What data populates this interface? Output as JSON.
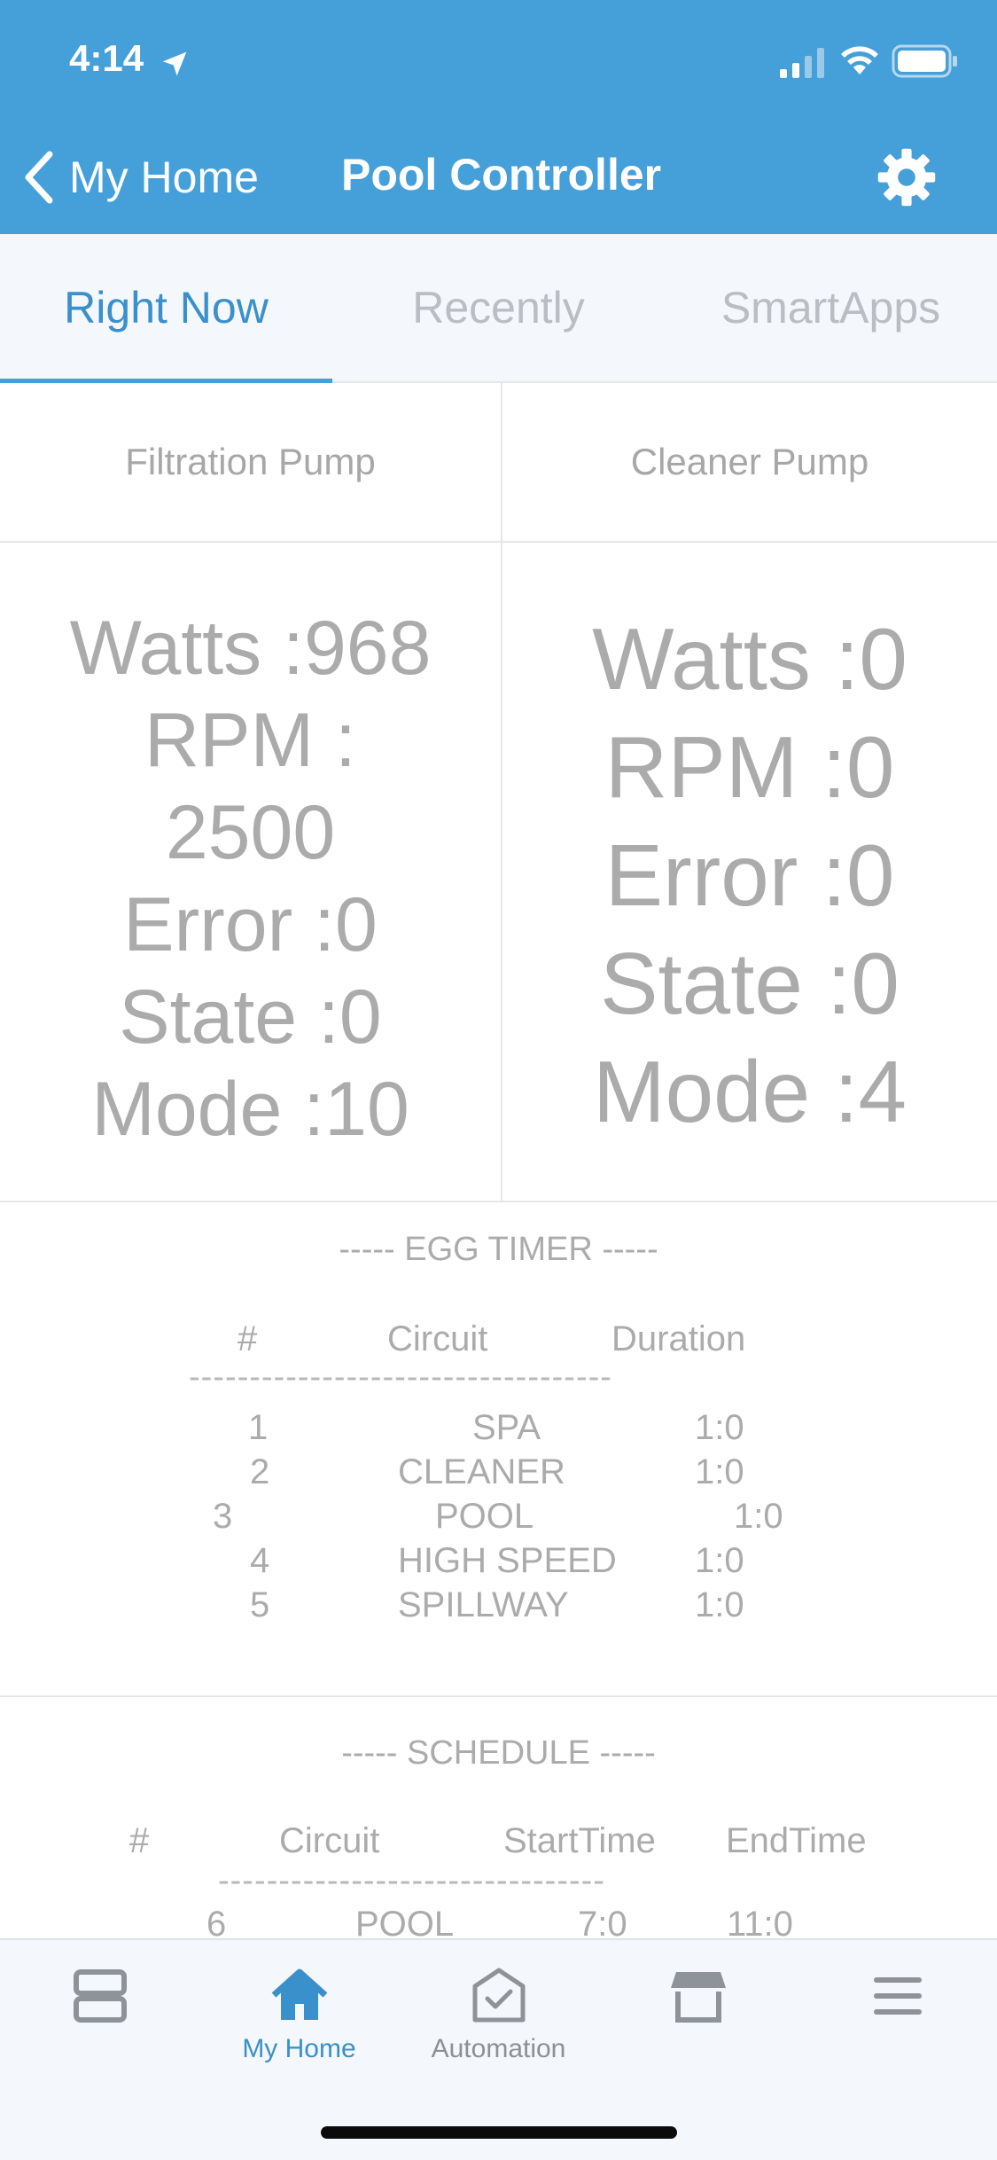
{
  "status_bar": {
    "time": "4:14"
  },
  "header": {
    "back_label": "My Home",
    "title": "Pool Controller"
  },
  "tabs": [
    {
      "label": "Right Now",
      "active": true
    },
    {
      "label": "Recently",
      "active": false
    },
    {
      "label": "SmartApps",
      "active": false
    }
  ],
  "filtration_pump": {
    "label": "Filtration Pump",
    "lines": [
      "Watts :968",
      "RPM :",
      "2500",
      "Error :0",
      "State :0",
      "Mode :10"
    ]
  },
  "cleaner_pump": {
    "label": "Cleaner Pump",
    "lines": [
      "Watts :0",
      "RPM :0",
      "Error :0",
      "State :0",
      "Mode :4"
    ]
  },
  "egg_timer": {
    "title": "----- EGG TIMER -----",
    "headers": [
      "#",
      "Circuit",
      "Duration"
    ],
    "divider": "-----------------------------------",
    "rows": [
      {
        "num": "1",
        "circuit": "SPA",
        "duration": "1:0"
      },
      {
        "num": "2",
        "circuit": "CLEANER",
        "duration": "1:0"
      },
      {
        "num": "3",
        "circuit": "POOL",
        "duration": "1:0"
      },
      {
        "num": "4",
        "circuit": "HIGH SPEED",
        "duration": "1:0"
      },
      {
        "num": "5",
        "circuit": "SPILLWAY",
        "duration": "1:0"
      }
    ]
  },
  "schedule": {
    "title": "----- SCHEDULE -----",
    "headers": [
      "#",
      "Circuit",
      "StartTime",
      "EndTime"
    ],
    "divider": "--------------------------------",
    "rows": [
      {
        "num": "6",
        "circuit": "POOL",
        "start": "7:0",
        "end": "11:0"
      }
    ]
  },
  "bottom_nav": [
    {
      "label": "",
      "icon": "dashboard-icon",
      "active": false
    },
    {
      "label": "My Home",
      "icon": "home-icon",
      "active": true
    },
    {
      "label": "Automation",
      "icon": "automation-icon",
      "active": false
    },
    {
      "label": "",
      "icon": "marketplace-icon",
      "active": false
    },
    {
      "label": "",
      "icon": "menu-icon",
      "active": false
    }
  ],
  "colors": {
    "header": "#459fd8",
    "accent": "#3a90cb",
    "text_gray": "#ababab"
  }
}
